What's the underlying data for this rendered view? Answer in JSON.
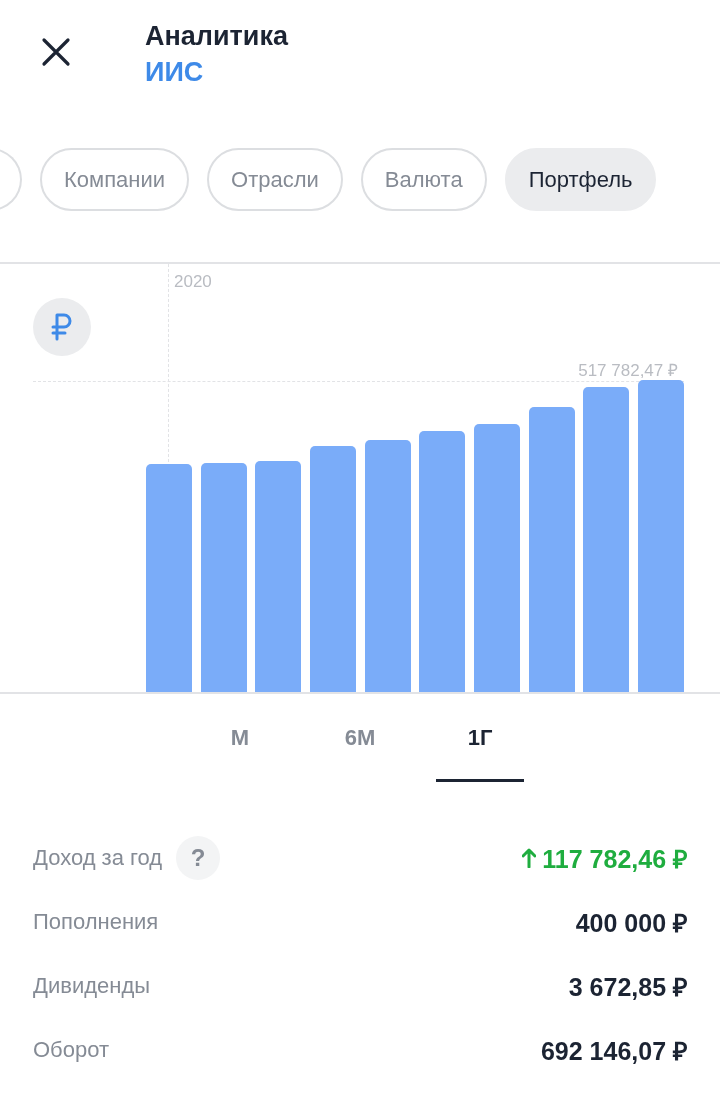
{
  "header": {
    "title": "Аналитика",
    "subtitle": "ИИС"
  },
  "chips": [
    {
      "label": "Компании",
      "selected": false
    },
    {
      "label": "Отрасли",
      "selected": false
    },
    {
      "label": "Валюта",
      "selected": false
    },
    {
      "label": "Портфель",
      "selected": true
    }
  ],
  "chart": {
    "year_label": "2020",
    "max_label": "517 782,47 ₽"
  },
  "periods": [
    {
      "label": "М",
      "selected": false
    },
    {
      "label": "6М",
      "selected": false
    },
    {
      "label": "1Г",
      "selected": true
    }
  ],
  "stats": [
    {
      "label": "Доход за год",
      "help": "?",
      "value": "117 782,46 ₽",
      "kind": "gain"
    },
    {
      "label": "Пополнения",
      "value": "400 000 ₽",
      "kind": "plain"
    },
    {
      "label": "Дивиденды",
      "value": "3 672,85 ₽",
      "kind": "plain"
    },
    {
      "label": "Оборот",
      "value": "692 146,07 ₽",
      "kind": "plain"
    }
  ]
}
